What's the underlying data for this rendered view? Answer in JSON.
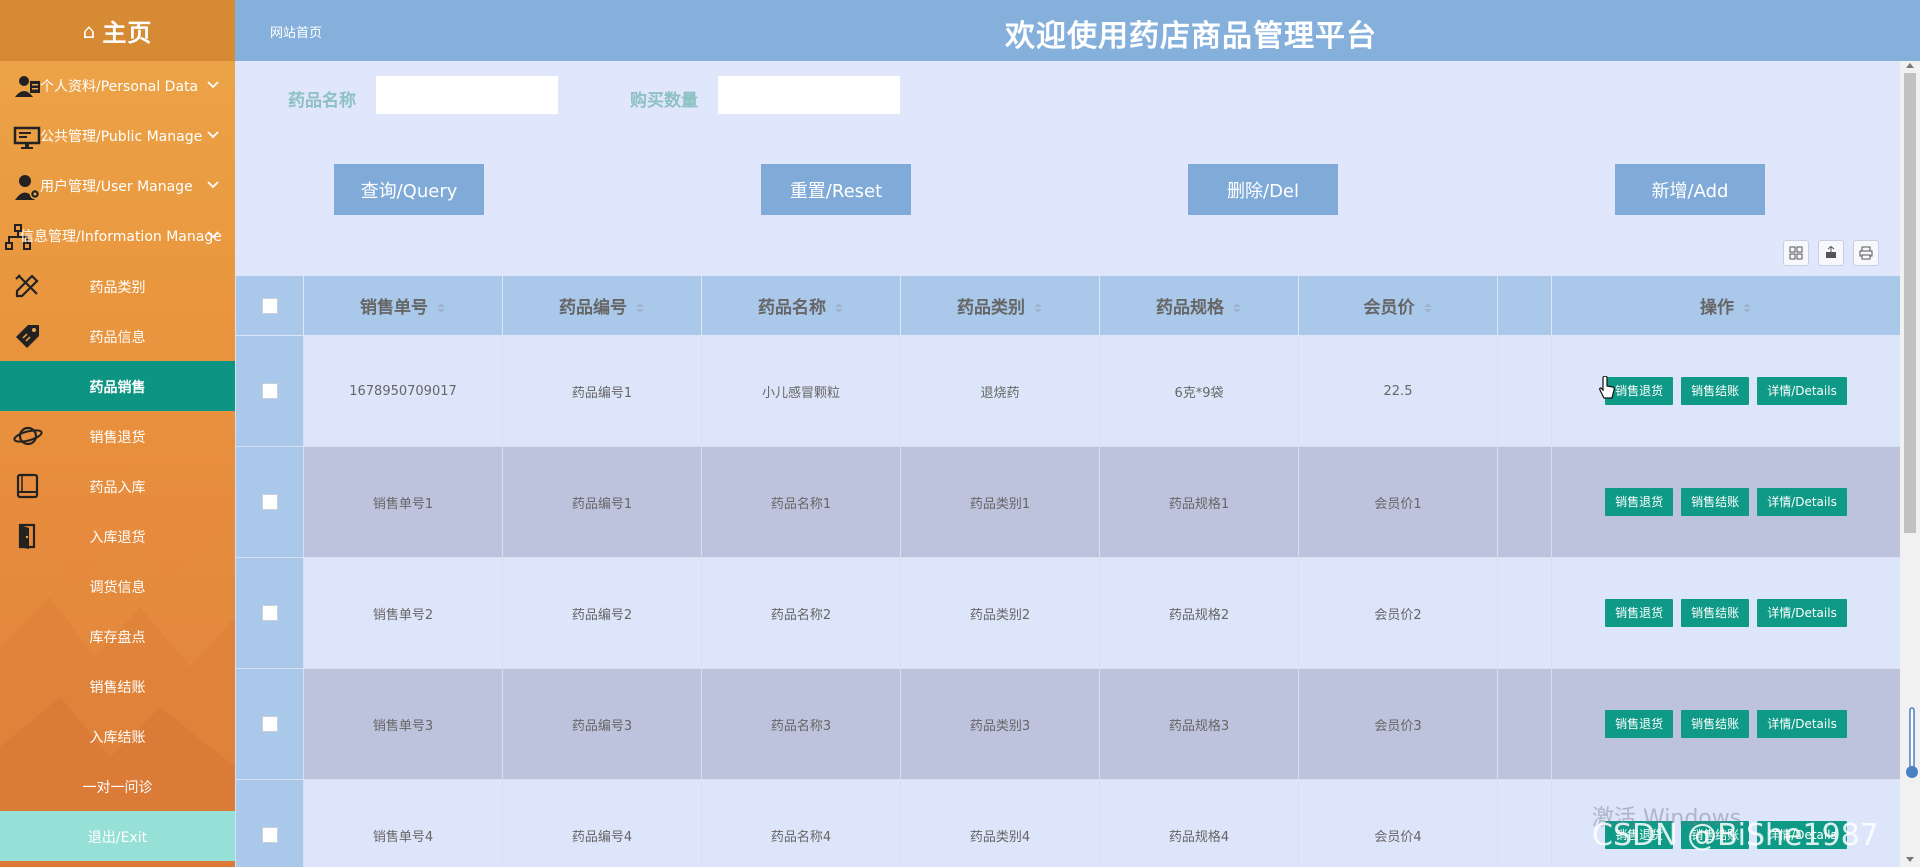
{
  "sidebar": {
    "home_label": "主页",
    "groups": [
      {
        "label": "个人资料/Personal Data",
        "icon": "personal-card-icon"
      },
      {
        "label": "公共管理/Public Manage",
        "icon": "monitor-icon"
      },
      {
        "label": "用户管理/User Manage",
        "icon": "user-gear-icon"
      },
      {
        "label": "信息管理/Information Manage",
        "icon": "sitemap-icon"
      }
    ],
    "items": [
      {
        "label": "药品类别",
        "icon": "pencil-ruler-icon"
      },
      {
        "label": "药品信息",
        "icon": "tag-icon"
      },
      {
        "label": "药品销售",
        "icon": ""
      },
      {
        "label": "销售退货",
        "icon": "planet-icon"
      },
      {
        "label": "药品入库",
        "icon": "book-icon"
      },
      {
        "label": "入库退货",
        "icon": "door-icon"
      },
      {
        "label": "调货信息",
        "icon": ""
      },
      {
        "label": "库存盘点",
        "icon": ""
      },
      {
        "label": "销售结账",
        "icon": ""
      },
      {
        "label": "入库结账",
        "icon": ""
      },
      {
        "label": "一对一问诊",
        "icon": ""
      },
      {
        "label": "退出/Exit",
        "icon": ""
      }
    ],
    "active_item": "药品销售"
  },
  "header": {
    "breadcrumb": "网站首页",
    "title": "欢迎使用药店商品管理平台"
  },
  "search": {
    "field1_label": "药品名称",
    "field1_value": "",
    "field2_label": "购买数量",
    "field2_value": "",
    "buttons": {
      "query": "查询/Query",
      "reset": "重置/Reset",
      "delete": "删除/Del",
      "add": "新增/Add"
    }
  },
  "toolbar_icons": [
    "grid-toggle-icon",
    "export-icon",
    "print-icon"
  ],
  "table": {
    "columns": [
      "销售单号",
      "药品编号",
      "药品名称",
      "药品类别",
      "药品规格",
      "会员价",
      "",
      "操作"
    ],
    "row_actions": [
      "销售退货",
      "销售结账",
      "详情/Details"
    ],
    "rows": [
      [
        "1678950709017",
        "药品编号1",
        "小儿感冒颗粒",
        "退烧药",
        "6克*9袋",
        "22.5"
      ],
      [
        "销售单号1",
        "药品编号1",
        "药品名称1",
        "药品类别1",
        "药品规格1",
        "会员价1"
      ],
      [
        "销售单号2",
        "药品编号2",
        "药品名称2",
        "药品类别2",
        "药品规格2",
        "会员价2"
      ],
      [
        "销售单号3",
        "药品编号3",
        "药品名称3",
        "药品类别3",
        "药品规格3",
        "会员价3"
      ],
      [
        "销售单号4",
        "药品编号4",
        "药品名称4",
        "药品类别4",
        "药品规格4",
        "会员价4"
      ]
    ]
  },
  "overlay": {
    "windows_watermark": "激活 Windows",
    "csdn_watermark": "CSDN @BiShe1987"
  },
  "colors": {
    "sidebar_orange": "#e9963e",
    "active_teal": "#0d9483",
    "header_blue": "#86b0dc",
    "button_blue": "#80aad7",
    "action_green": "#0e9a86"
  }
}
